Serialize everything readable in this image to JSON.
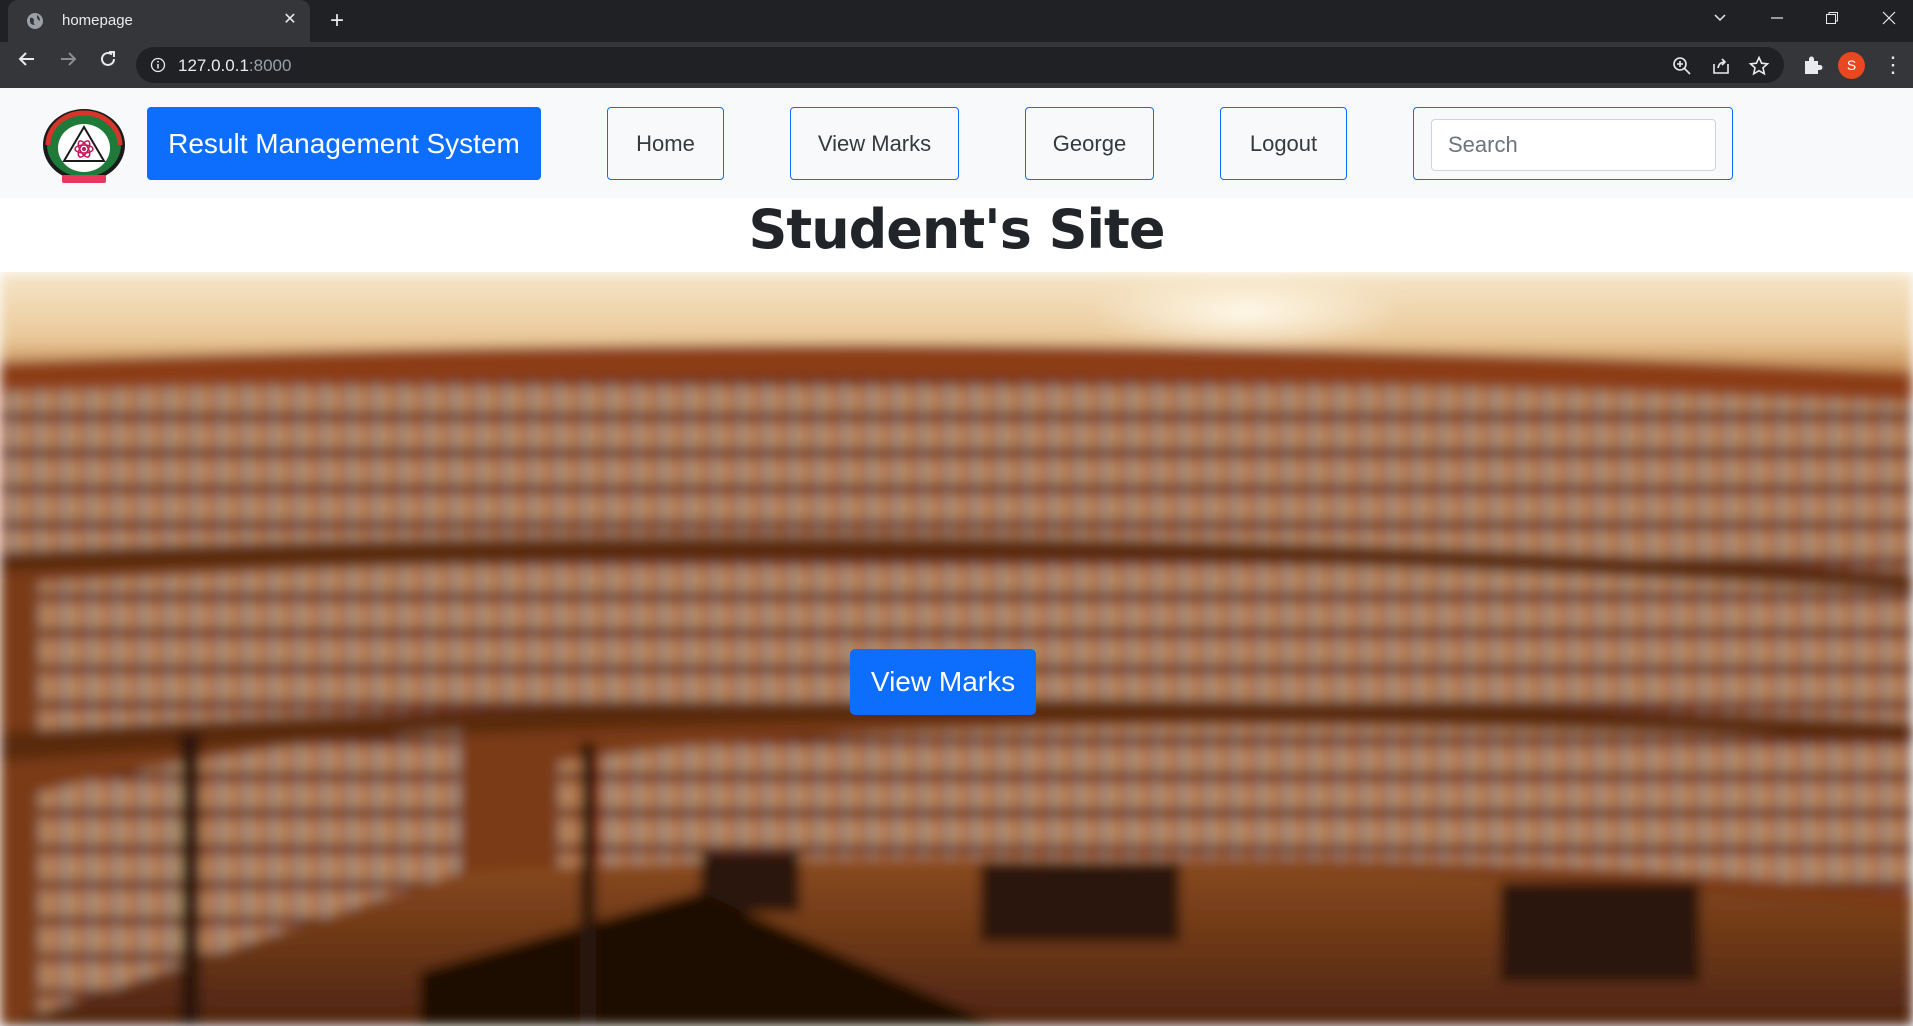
{
  "browser": {
    "tab_title": "homepage",
    "url_host": "127.0.0.1",
    "url_port": ":8000",
    "profile_initial": "S",
    "icons": [
      "globe-icon",
      "close-icon",
      "plus-icon",
      "chevron-down-icon",
      "minimize-icon",
      "restore-icon",
      "window-close-icon",
      "back-icon",
      "forward-icon",
      "reload-icon",
      "info-icon",
      "zoom-icon",
      "share-icon",
      "star-icon",
      "puzzle-icon",
      "kebab-menu-icon"
    ]
  },
  "navbar": {
    "brand": "Result Management System",
    "links": [
      "Home",
      "View Marks",
      "George",
      "Logout"
    ],
    "search_placeholder": "Search"
  },
  "main": {
    "heading": "Student's Site",
    "hero_button": "View Marks"
  },
  "colors": {
    "primary": "#0d6efd",
    "chrome_dark": "#202124",
    "chrome_tab": "#35363a",
    "navbar_bg": "#f8f9fa",
    "profile": "#e8471f"
  }
}
